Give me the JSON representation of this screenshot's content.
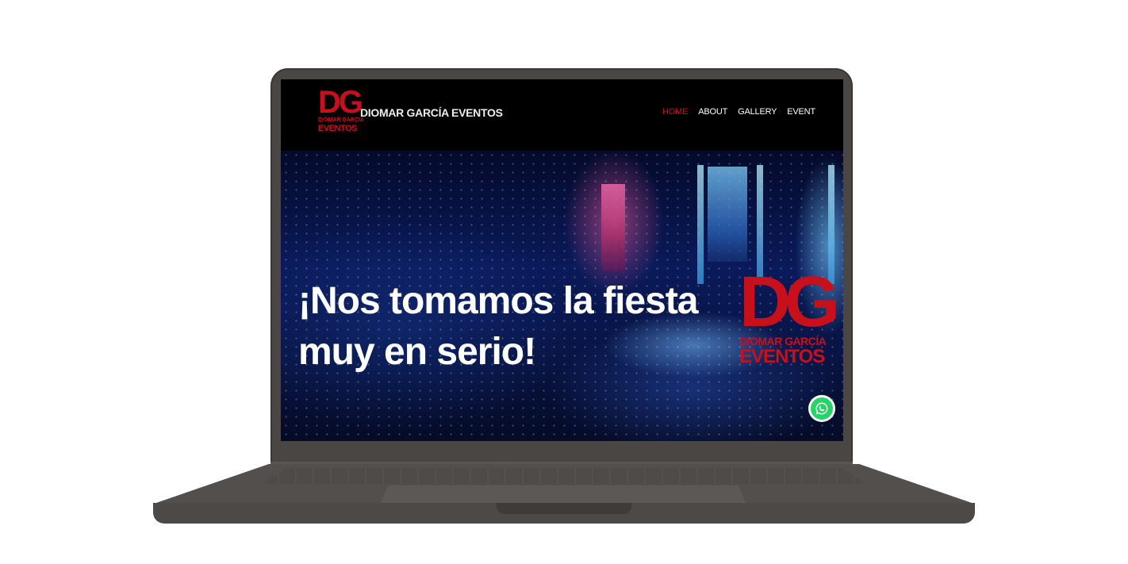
{
  "site": {
    "brand_name": "DIOMAR GARCÍA EVENTOS",
    "logo": {
      "initials": "DG",
      "line1": "DIOMAR GARCÍA",
      "line2": "EVENTOS"
    }
  },
  "nav": {
    "items": [
      {
        "label": "HOME",
        "active": true
      },
      {
        "label": "ABOUT",
        "active": false
      },
      {
        "label": "GALLERY",
        "active": false
      },
      {
        "label": "EVENT",
        "active": false
      }
    ]
  },
  "hero": {
    "title": "¡Nos tomamos la fiesta muy en serio!",
    "logo": {
      "initials": "DG",
      "line1": "DIOMAR GARCÍA",
      "line2": "EVENTOS"
    }
  },
  "icons": {
    "whatsapp": "whatsapp-icon"
  },
  "colors": {
    "accent": "#c8101a",
    "header_bg": "#000000",
    "whatsapp": "#25d366"
  }
}
